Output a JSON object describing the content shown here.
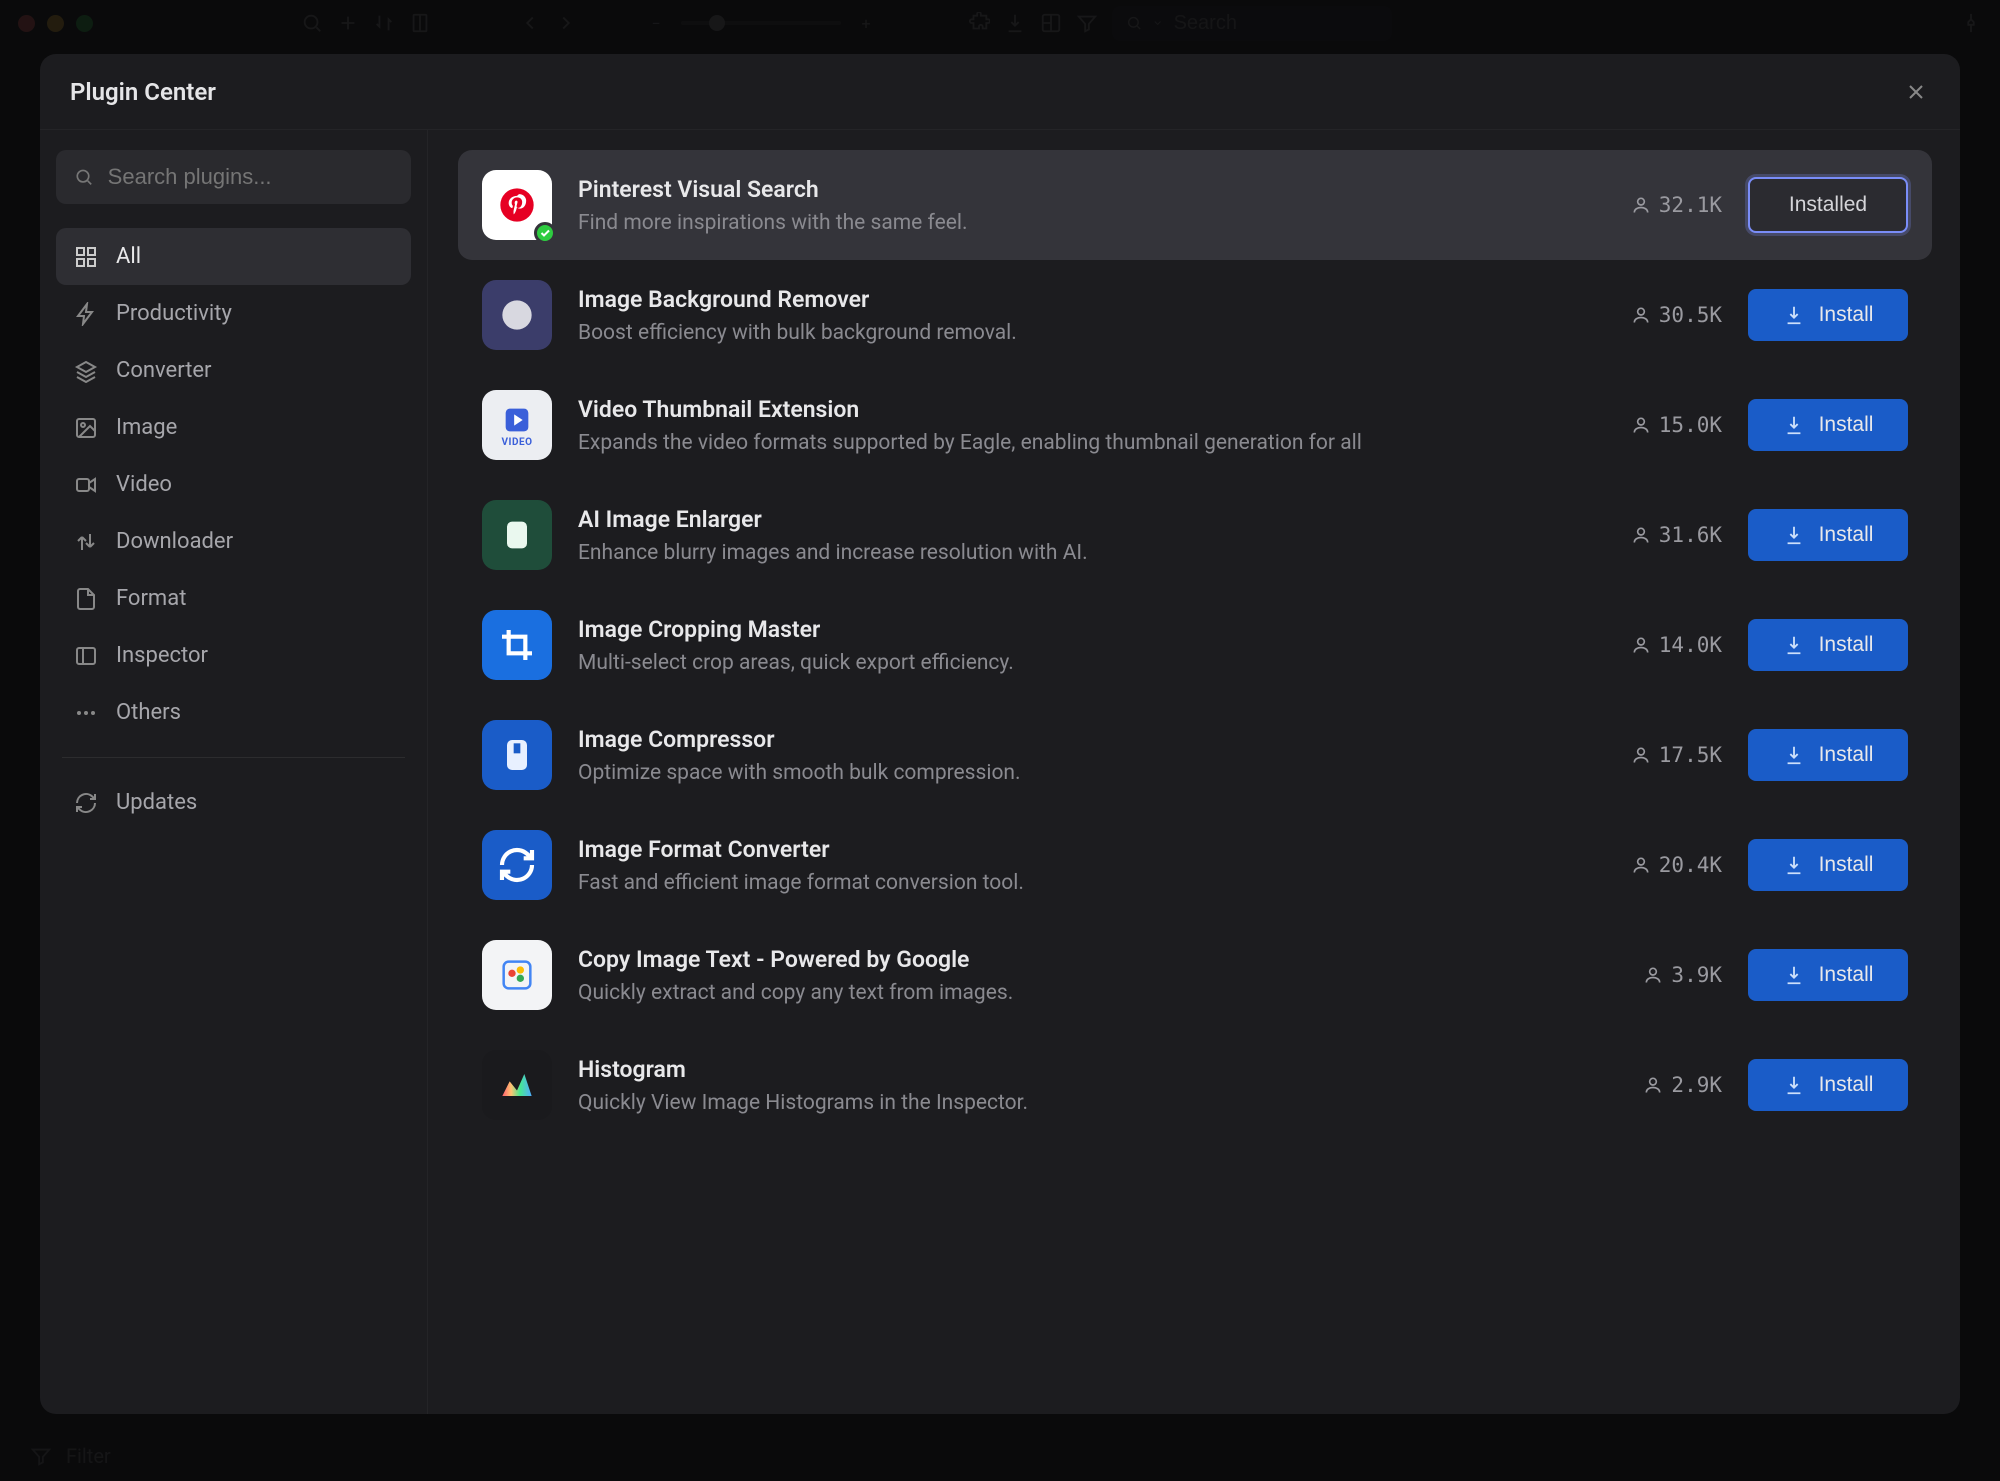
{
  "app_toolbar": {
    "search_placeholder": "Search"
  },
  "modal": {
    "title": "Plugin Center",
    "search_placeholder": "Search plugins..."
  },
  "sidebar": {
    "items": [
      {
        "label": "All",
        "icon": "grid",
        "active": true
      },
      {
        "label": "Productivity",
        "icon": "bolt"
      },
      {
        "label": "Converter",
        "icon": "stack"
      },
      {
        "label": "Image",
        "icon": "image"
      },
      {
        "label": "Video",
        "icon": "video"
      },
      {
        "label": "Downloader",
        "icon": "updown"
      },
      {
        "label": "Format",
        "icon": "document"
      },
      {
        "label": "Inspector",
        "icon": "sidebar"
      },
      {
        "label": "Others",
        "icon": "dots"
      }
    ],
    "updates_label": "Updates"
  },
  "plugins": [
    {
      "name": "Pinterest Visual Search",
      "desc": "Find more inspirations with the same feel.",
      "users": "32.1K",
      "action": "Installed",
      "installed": true,
      "iconClass": "ic-pinterest",
      "iconName": "pinterest-icon"
    },
    {
      "name": "Image Background Remover",
      "desc": "Boost efficiency with bulk background removal.",
      "users": "30.5K",
      "action": "Install",
      "installed": false,
      "iconClass": "ic-bgremove",
      "iconName": "bgremove-icon"
    },
    {
      "name": "Video Thumbnail Extension",
      "desc": "Expands the video formats supported by Eagle, enabling thumbnail generation for all",
      "users": "15.0K",
      "action": "Install",
      "installed": false,
      "iconClass": "ic-video",
      "iconName": "video-thumb-icon"
    },
    {
      "name": "AI Image Enlarger",
      "desc": "Enhance blurry images and increase resolution with AI.",
      "users": "31.6K",
      "action": "Install",
      "installed": false,
      "iconClass": "ic-enlarger",
      "iconName": "enlarger-icon"
    },
    {
      "name": "Image Cropping Master",
      "desc": "Multi-select crop areas, quick export efficiency.",
      "users": "14.0K",
      "action": "Install",
      "installed": false,
      "iconClass": "ic-crop",
      "iconName": "crop-icon"
    },
    {
      "name": "Image Compressor",
      "desc": "Optimize space with smooth bulk compression.",
      "users": "17.5K",
      "action": "Install",
      "installed": false,
      "iconClass": "ic-compress",
      "iconName": "compress-icon"
    },
    {
      "name": "Image Format Converter",
      "desc": "Fast and efficient image format conversion tool.",
      "users": "20.4K",
      "action": "Install",
      "installed": false,
      "iconClass": "ic-format",
      "iconName": "convert-icon"
    },
    {
      "name": "Copy Image Text - Powered by Google",
      "desc": "Quickly extract and copy any text from images.",
      "users": "3.9K",
      "action": "Install",
      "installed": false,
      "iconClass": "ic-ocr",
      "iconName": "ocr-icon"
    },
    {
      "name": "Histogram",
      "desc": "Quickly View Image Histograms in the Inspector.",
      "users": "2.9K",
      "action": "Install",
      "installed": false,
      "iconClass": "ic-histogram",
      "iconName": "histogram-icon"
    }
  ],
  "bottom_bar": {
    "filter_label": "Filter"
  }
}
